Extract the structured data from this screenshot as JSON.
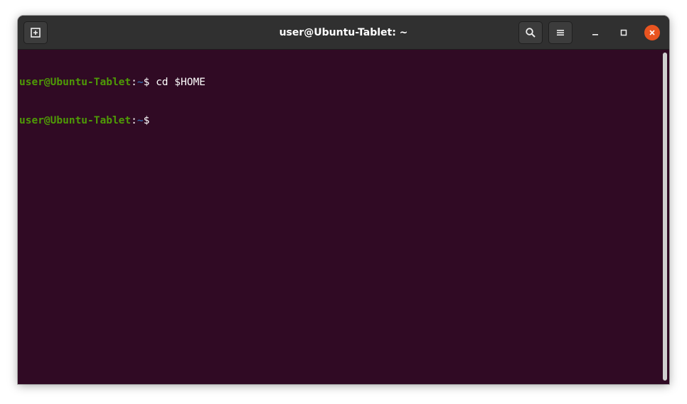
{
  "window": {
    "title": "user@Ubuntu-Tablet: ~"
  },
  "titlebar": {
    "new_tab_icon": "new-tab-icon",
    "search_icon": "search-icon",
    "menu_icon": "hamburger-menu-icon",
    "minimize_icon": "minimize-icon",
    "maximize_icon": "maximize-icon",
    "close_icon": "close-icon",
    "close_color": "#e95420"
  },
  "terminal": {
    "background": "#300a24",
    "lines": [
      {
        "user_host": "user@Ubuntu-Tablet",
        "colon": ":",
        "path": "~",
        "dollar": "$",
        "command": " cd $HOME"
      },
      {
        "user_host": "user@Ubuntu-Tablet",
        "colon": ":",
        "path": "~",
        "dollar": "$",
        "command": ""
      }
    ]
  }
}
